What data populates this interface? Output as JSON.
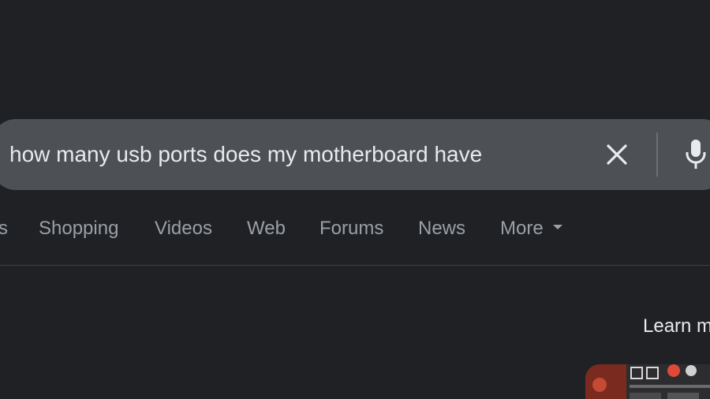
{
  "search": {
    "query": "how many usb ports does my motherboard have"
  },
  "icons": {
    "clear": "close-icon",
    "mic": "microphone-icon",
    "more": "caret-down-icon"
  },
  "tabs": [
    {
      "label": "s"
    },
    {
      "label": "Shopping"
    },
    {
      "label": "Videos"
    },
    {
      "label": "Web"
    },
    {
      "label": "Forums"
    },
    {
      "label": "News"
    },
    {
      "label": "More"
    }
  ],
  "result": {
    "learn_more": "Learn m"
  },
  "colors": {
    "background": "#202124",
    "search_box": "#4d5156",
    "tab_text": "#9aa0a6",
    "primary_text": "#e8eaed"
  }
}
